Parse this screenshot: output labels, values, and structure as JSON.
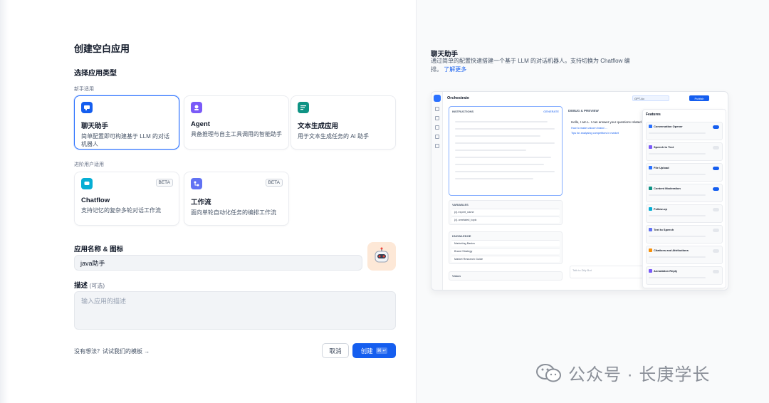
{
  "dialog": {
    "title": "创建空白应用",
    "type_section_label": "选择应用类型",
    "beginner_group_label": "新手适用",
    "advanced_group_label": "进阶用户适用",
    "app_types": [
      {
        "name": "聊天助手",
        "desc": "简单配置即可构建基于 LLM 的对话机器人",
        "icon": "chat-bubble-icon",
        "color": "#155eef",
        "selected": true
      },
      {
        "name": "Agent",
        "desc": "具备推理与自主工具调用的智能助手",
        "icon": "agent-icon",
        "color": "#7a5af8",
        "selected": false
      },
      {
        "name": "文本生成应用",
        "desc": "用于文本生成任务的 AI 助手",
        "icon": "text-generation-icon",
        "color": "#0e9384",
        "selected": false
      }
    ],
    "advanced_types": [
      {
        "name": "Chatflow",
        "desc": "支持记忆的复杂多轮对话工作流",
        "badge": "BETA",
        "icon": "chatflow-icon",
        "color": "#06aed4"
      },
      {
        "name": "工作流",
        "desc": "面向单轮自动化任务的编排工作流",
        "badge": "BETA",
        "icon": "workflow-icon",
        "color": "#6172f3"
      }
    ],
    "name_label": "应用名称 & 图标",
    "name_value": "java助手",
    "desc_label": "描述",
    "desc_optional": "(可选)",
    "desc_placeholder": "输入应用的描述",
    "footer_hint": "没有想法？试试我们的模板 →",
    "cancel_label": "取消",
    "create_label": "创建",
    "create_shortcut": "⌘ ↵"
  },
  "preview": {
    "title": "聊天助手",
    "desc": "通过简单的配置快速搭建一个基于 LLM 的对话机器人。支持切换为 Chatflow 编排。",
    "learn_more": "了解更多",
    "mock": {
      "header": "Orchestrate",
      "model": "GPT-4o",
      "publish": "Publish",
      "instructions": "INSTRUCTIONS",
      "generate": "GENERATE",
      "variables": "VARIABLES",
      "var_rows": [
        "{x} expert_name",
        "{x} unrelated_topic"
      ],
      "knowledge": "KNOWLEDGE",
      "knowledge_rows": [
        "Marketing Basics",
        "Brand Strategy",
        "Market Research Guide"
      ],
      "vision": "Vision",
      "debug": "DEBUG & PREVIEW",
      "greeting": "Hello, I am L. I can answer your questions related",
      "suggestions": [
        "How to make unicorn brand ...",
        "Tips for analysing competitors in market"
      ],
      "input_placeholder": "Talk to Dify Bot",
      "features_title": "Features",
      "features": [
        {
          "name": "Conversation Opener",
          "on": true,
          "color": "#2970ff"
        },
        {
          "name": "Speech to Text",
          "on": false,
          "color": "#7a5af8"
        },
        {
          "name": "File Upload",
          "on": true,
          "color": "#2970ff"
        },
        {
          "name": "Content Moderation",
          "on": true,
          "color": "#0e9384"
        },
        {
          "name": "Follow-up",
          "on": false,
          "color": "#06aed4"
        },
        {
          "name": "Text to Speech",
          "on": false,
          "color": "#6172f3"
        },
        {
          "name": "Citations and Attributions",
          "on": false,
          "color": "#f79009"
        },
        {
          "name": "Annotation Reply",
          "on": false,
          "color": "#7a5af8"
        }
      ]
    }
  },
  "watermark": {
    "text": "公众号 · 长庚学长"
  }
}
